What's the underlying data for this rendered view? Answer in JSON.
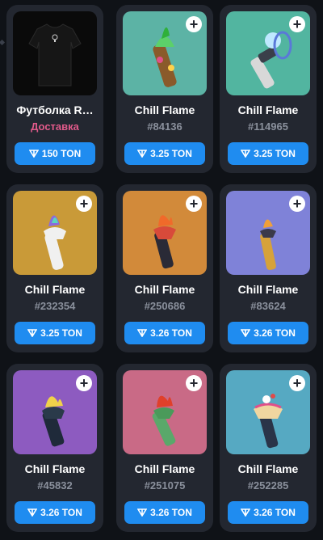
{
  "cards": [
    {
      "title": "Футболка R…",
      "subtitle": "Доставка",
      "price": "150 TON",
      "bg": "#0a0a0a",
      "has_plus": false
    },
    {
      "title": "Chill Flame",
      "subtitle": "#84136",
      "price": "3.25 TON",
      "bg": "#5cb3a5",
      "has_plus": true
    },
    {
      "title": "Chill Flame",
      "subtitle": "#114965",
      "price": "3.25 TON",
      "bg": "#52b5a0",
      "has_plus": true
    },
    {
      "title": "Chill Flame",
      "subtitle": "#232354",
      "price": "3.25 TON",
      "bg": "#c99a38",
      "has_plus": true
    },
    {
      "title": "Chill Flame",
      "subtitle": "#250686",
      "price": "3.26 TON",
      "bg": "#d28a3a",
      "has_plus": true
    },
    {
      "title": "Chill Flame",
      "subtitle": "#83624",
      "price": "3.26 TON",
      "bg": "#7f82d8",
      "has_plus": true
    },
    {
      "title": "Chill Flame",
      "subtitle": "#45832",
      "price": "3.26 TON",
      "bg": "#8d5bc0",
      "has_plus": true
    },
    {
      "title": "Chill Flame",
      "subtitle": "#251075",
      "price": "3.26 TON",
      "bg": "#c96a86",
      "has_plus": true
    },
    {
      "title": "Chill Flame",
      "subtitle": "#252285",
      "price": "3.26 TON",
      "bg": "#56a9c2",
      "has_plus": true
    }
  ],
  "colors": {
    "page_bg": "#0f1217",
    "card_bg": "#232730",
    "accent_button": "#1f8cf0",
    "delivery_text": "#e05a8a",
    "muted_text": "#8a909c"
  },
  "icons": {
    "currency": "ton-diamond-icon",
    "add": "plus-icon"
  }
}
